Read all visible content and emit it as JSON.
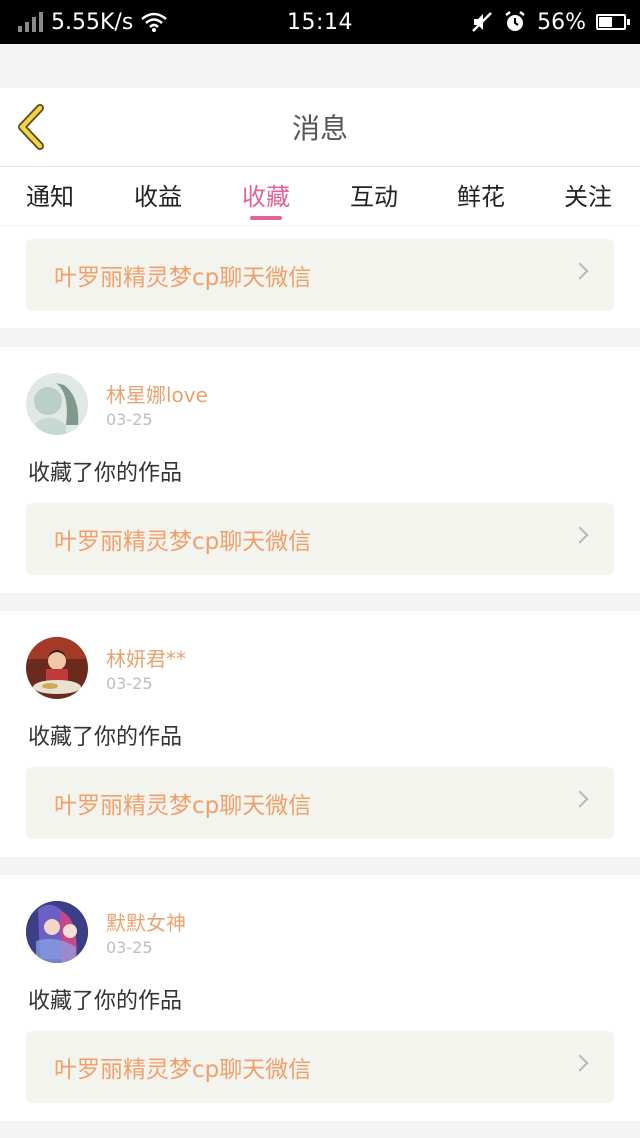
{
  "status_bar": {
    "network_speed": "5.55K/s",
    "time": "15:14",
    "battery": "56%",
    "battery_level": 0.56,
    "icons": [
      "signal-icon",
      "wifi-icon",
      "mute-icon",
      "alarm-icon",
      "battery-icon"
    ]
  },
  "header": {
    "title": "消息",
    "back_icon": "chevron-left-icon",
    "accent_color": "#e0639a",
    "back_color": "#f2d44a"
  },
  "tabs": [
    {
      "label": "通知"
    },
    {
      "label": "收益"
    },
    {
      "label": "收藏",
      "active": true
    },
    {
      "label": "互动"
    },
    {
      "label": "鲜花"
    },
    {
      "label": "关注"
    }
  ],
  "first_item": {
    "work_title": "叶罗丽精灵梦cp聊天微信"
  },
  "items": [
    {
      "user": "林星娜love",
      "date": "03-25",
      "action": "收藏了你的作品",
      "work_title": "叶罗丽精灵梦cp聊天微信"
    },
    {
      "user": "林妍君**",
      "date": "03-25",
      "action": "收藏了你的作品",
      "work_title": "叶罗丽精灵梦cp聊天微信"
    },
    {
      "user": "默默女神",
      "date": "03-25",
      "action": "收藏了你的作品",
      "work_title": "叶罗丽精灵梦cp聊天微信"
    }
  ]
}
